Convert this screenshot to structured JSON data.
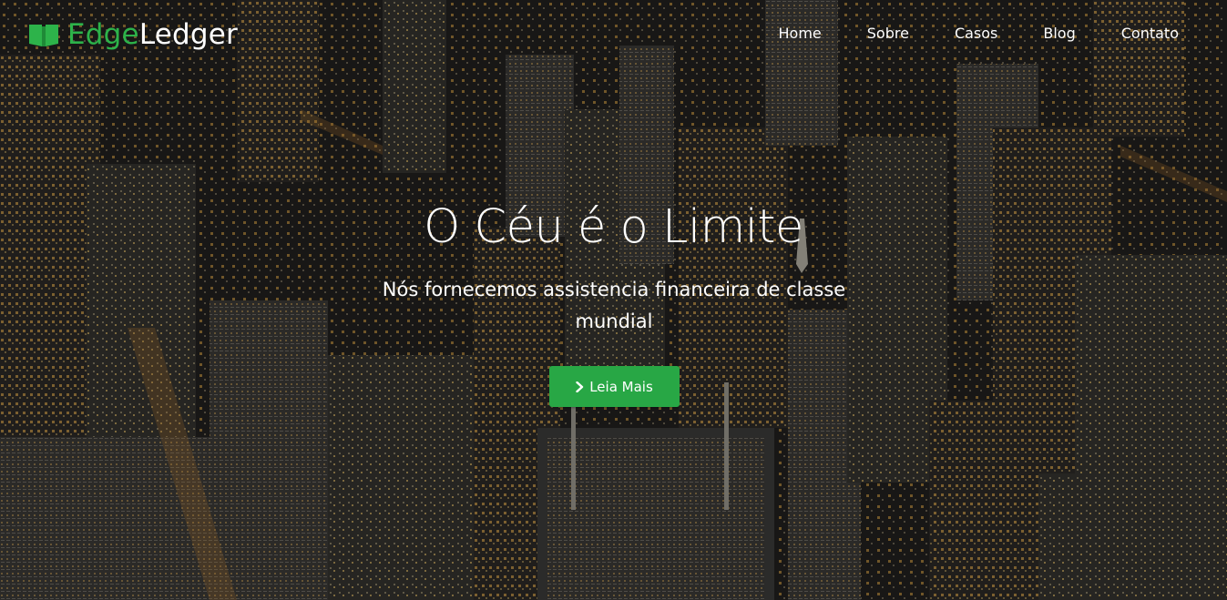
{
  "brand": {
    "part1": "Edge",
    "part2": "Ledger",
    "icon": "open-book-icon",
    "accent_color": "#2db34a"
  },
  "nav": {
    "items": [
      {
        "label": "Home"
      },
      {
        "label": "Sobre"
      },
      {
        "label": "Casos"
      },
      {
        "label": "Blog"
      },
      {
        "label": "Contato"
      }
    ]
  },
  "hero": {
    "title": "O Céu é o Limite",
    "subtitle": "Nós fornecemos assistencia financeira de classe mundial",
    "cta_label": "Leia Mais",
    "cta_icon": "chevron-right-icon",
    "cta_color": "#28a745",
    "background": "night-city-aerial-photo"
  }
}
